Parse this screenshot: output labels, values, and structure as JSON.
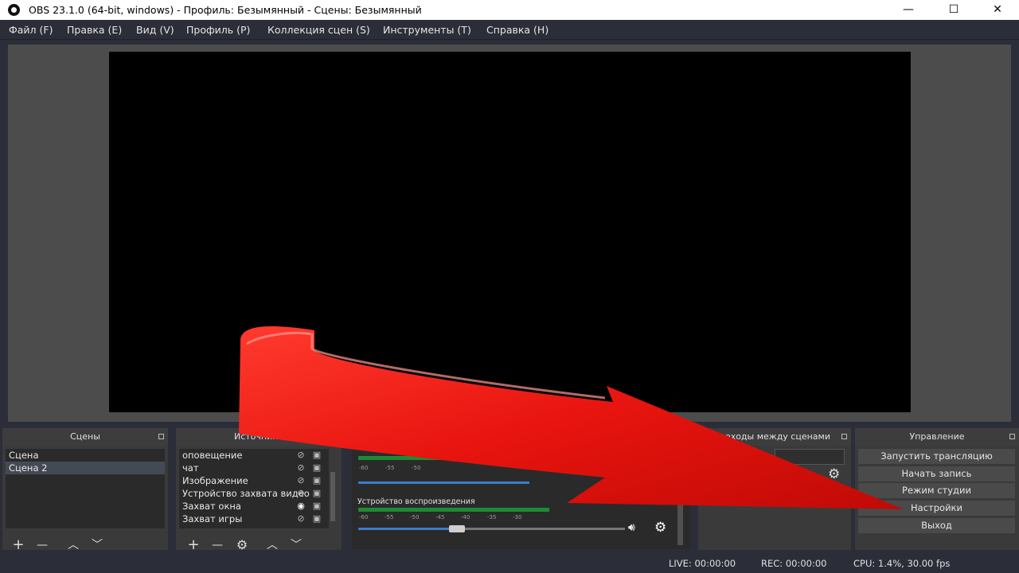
{
  "window": {
    "title": "OBS 23.1.0 (64-bit, windows) - Профиль: Безымянный - Сцены: Безымянный",
    "minimize": "—",
    "maximize": "☐",
    "close": "✕"
  },
  "menu": [
    "Файл (F)",
    "Правка (E)",
    "Вид (V)",
    "Профиль (P)",
    "Коллекция сцен (S)",
    "Инструменты (T)",
    "Справка (H)"
  ],
  "scenes": {
    "title": "Сцены",
    "items": [
      "Сцена",
      "Сцена 2"
    ]
  },
  "sources": {
    "title": "Источники",
    "items": [
      "оповещение",
      "чат",
      "Изображение",
      "Устройство захвата видео",
      "Захват окна",
      "Захват игры"
    ],
    "visible": [
      false,
      false,
      false,
      false,
      true,
      false
    ]
  },
  "mixer": {
    "channel_label": "Устройство воспроизведения",
    "scale_top": [
      "-60",
      "-55",
      "-50"
    ],
    "scale": [
      "-60",
      "-55",
      "-50",
      "-45",
      "-40",
      "-35",
      "-30"
    ],
    "volume_level": 0.37
  },
  "transitions": {
    "title": "Переходы между сценами"
  },
  "controls": {
    "title": "Управление",
    "start_stream": "Запустить трансляцию",
    "start_recording": "Начать запись",
    "studio_mode": "Режим студии",
    "settings": "Настройки",
    "exit": "Выход"
  },
  "status": {
    "live": "LIVE: 00:00:00",
    "rec": "REC: 00:00:00",
    "cpu": "CPU: 1.4%, 30.00 fps"
  },
  "toolbar_icons": {
    "add": "+",
    "remove": "—",
    "up": "︿",
    "down": "﹀",
    "gear": "⚙"
  },
  "colors": {
    "accent_slider": "#3a7ec9",
    "meter_green": "#1f8a34",
    "arrow_red": "#e8140f"
  }
}
